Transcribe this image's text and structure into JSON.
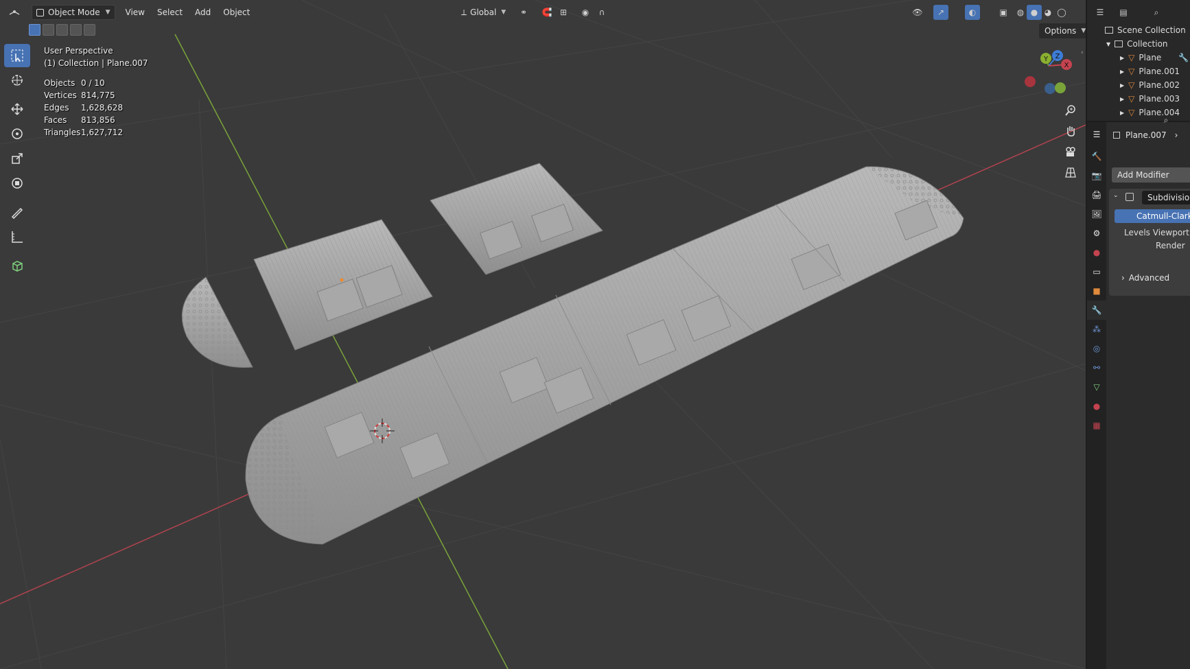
{
  "header": {
    "mode": "Object Mode",
    "menus": [
      "View",
      "Select",
      "Add",
      "Object"
    ],
    "transform_orientation": "Global"
  },
  "overlay": {
    "view_name": "User Perspective",
    "collection_info": "(1) Collection | Plane.007",
    "stats": [
      {
        "label": "Objects",
        "value": "0 / 10"
      },
      {
        "label": "Vertices",
        "value": "814,775"
      },
      {
        "label": "Edges",
        "value": "1,628,628"
      },
      {
        "label": "Faces",
        "value": "813,856"
      },
      {
        "label": "Triangles",
        "value": "1,627,712"
      }
    ]
  },
  "viewport": {
    "options_label": "Options",
    "gizmo": {
      "x": "X",
      "y": "Y",
      "z": "Z"
    }
  },
  "outliner": {
    "scene_collection": "Scene Collection",
    "collection": "Collection",
    "items": [
      "Plane",
      "Plane.001",
      "Plane.002",
      "Plane.003",
      "Plane.004"
    ]
  },
  "properties": {
    "object_name": "Plane.007",
    "add_modifier": "Add Modifier",
    "modifier_name": "Subdivision",
    "modifier_type": "Catmull-Clark",
    "levels_viewport": "Levels Viewport",
    "render": "Render",
    "advanced": "Advanced"
  },
  "colors": {
    "accent": "#4772b3",
    "x_axis": "#c4434f",
    "y_axis": "#8ab030",
    "z_axis": "#3d7cd6",
    "mesh_icon": "#e08a3c"
  }
}
